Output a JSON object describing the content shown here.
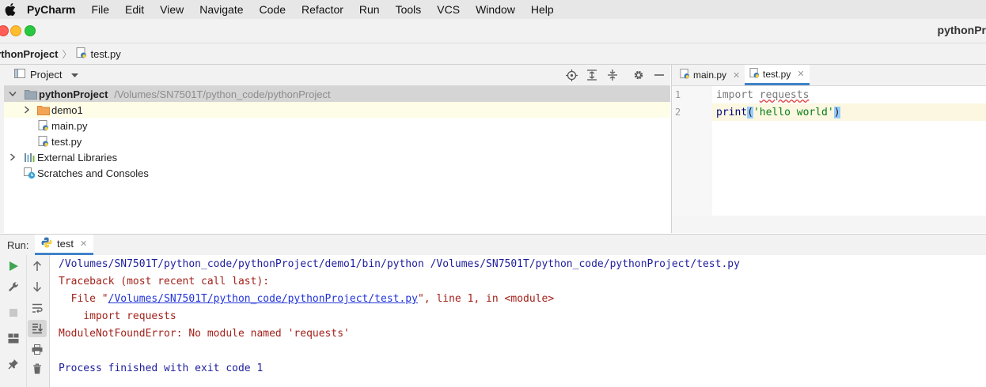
{
  "menubar": {
    "app": "PyCharm",
    "items": [
      "File",
      "Edit",
      "View",
      "Navigate",
      "Code",
      "Refactor",
      "Run",
      "Tools",
      "VCS",
      "Window",
      "Help"
    ]
  },
  "window": {
    "title": "pythonPr"
  },
  "breadcrumb": {
    "root": "ythonProject",
    "file": "test.py"
  },
  "project_panel": {
    "title": "Project",
    "tree": [
      {
        "label": "pythonProject",
        "path": "/Volumes/SN7501T/python_code/pythonProject"
      },
      {
        "label": "demo1"
      },
      {
        "label": "main.py"
      },
      {
        "label": "test.py"
      },
      {
        "label": "External Libraries"
      },
      {
        "label": "Scratches and Consoles"
      }
    ]
  },
  "editor": {
    "tabs": [
      {
        "label": "main.py"
      },
      {
        "label": "test.py"
      }
    ],
    "line_numbers": [
      "1",
      "2"
    ],
    "code": {
      "l1_kw": "import",
      "l1_mod": "requests",
      "l2_fn": "print",
      "l2_open": "(",
      "l2_str": "'hello world'",
      "l2_close": ")"
    }
  },
  "run_panel": {
    "label": "Run:",
    "tab": "test",
    "console": {
      "cmd": "/Volumes/SN7501T/python_code/pythonProject/demo1/bin/python /Volumes/SN7501T/python_code/pythonProject/test.py",
      "tb": "Traceback (most recent call last):",
      "file_prefix": "  File \"",
      "file_link": "/Volumes/SN7501T/python_code/pythonProject/test.py",
      "file_suffix": "\", line 1, in <module>",
      "import_line": "    import requests",
      "error": "ModuleNotFoundError: No module named 'requests'",
      "exit": "Process finished with exit code 1"
    }
  },
  "colors": {
    "accent": "#4083c9",
    "stdout": "#1e1e9e",
    "stderr": "#a3211a",
    "link": "#2235d8"
  }
}
